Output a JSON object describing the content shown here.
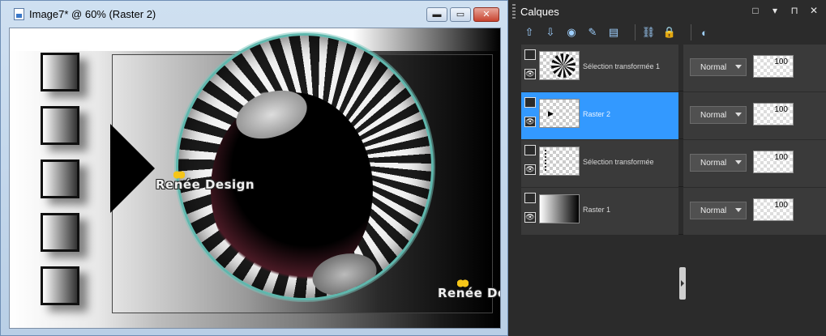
{
  "image_window": {
    "title": "Image7* @  60% (Raster 2)",
    "minimize_glyph": "▬",
    "maximize_glyph": "▭",
    "close_glyph": "✕",
    "watermark_1": "Renée Design",
    "watermark_2": "Renée Design"
  },
  "layers_panel": {
    "title": "Calques",
    "controls": [
      "□",
      "▾",
      "⊓",
      "✕"
    ],
    "toolbar_icons": [
      "new-raster-layer-icon",
      "new-vector-layer-icon",
      "layer-effects-icon",
      "layer-pen-icon",
      "layer-lock-icon",
      "link-layers-icon",
      "lock-transparency-icon",
      "layer-properties-icon"
    ],
    "layers": [
      {
        "name": "Sélection transformée 1",
        "blend": "Normal",
        "opacity": "100",
        "selected": false,
        "thumb": "sphere"
      },
      {
        "name": "Raster 2",
        "blend": "Normal",
        "opacity": "100",
        "selected": true,
        "thumb": "arrow"
      },
      {
        "name": "Sélection transformée",
        "blend": "Normal",
        "opacity": "100",
        "selected": false,
        "thumb": "lines"
      },
      {
        "name": "Raster 1",
        "blend": "Normal",
        "opacity": "100",
        "selected": false,
        "thumb": "gradient"
      }
    ]
  },
  "colors": {
    "selected_layer": "#3399ff",
    "panel_background": "#2b2b2b",
    "window_frame": "#b9cfe6"
  }
}
